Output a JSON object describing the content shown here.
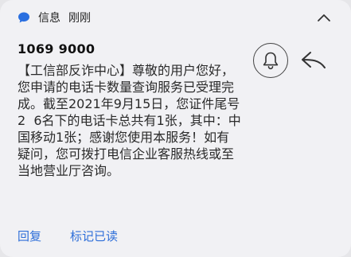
{
  "notification": {
    "app_name": "信息",
    "time": "刚刚",
    "sender": "1069 9000",
    "message": "【工信部反诈中心】尊敬的用户您好，您申请的电话卡数量查询服务已受理完成。截至2021年9月15日，您证件尾号2  6名下的电话卡总共有1张，其中：中国移动1张；感谢您使用本服务！如有疑问，您可拨打电信企业客服热线或至当地营业厅咨询。"
  },
  "actions": {
    "reply_label": "回复",
    "mark_read_label": "标记已读"
  },
  "icons": {
    "app": "message-bubble-icon",
    "collapse": "chevron-up-icon",
    "bell": "bell-icon",
    "reply": "reply-arrow-icon"
  },
  "colors": {
    "accent": "#2f6fd9",
    "app_icon": "#2a6fe0"
  }
}
